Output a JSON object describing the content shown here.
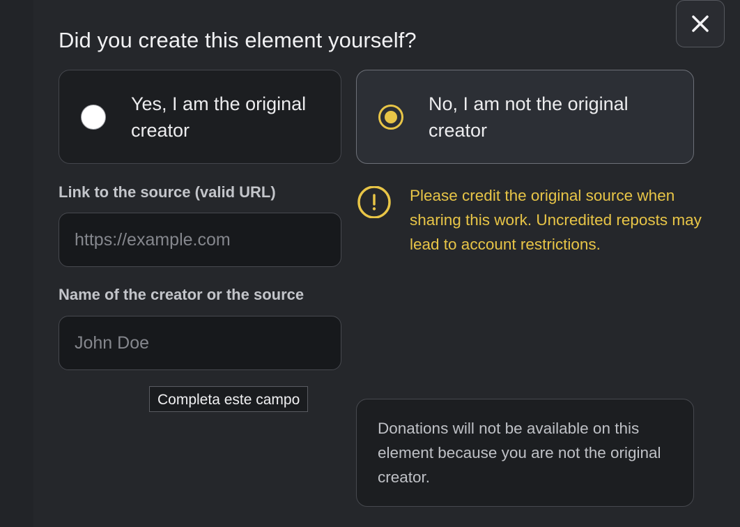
{
  "dialog": {
    "title": "Did you create this element yourself?",
    "close_icon": "close-icon"
  },
  "options": {
    "yes": {
      "label": "Yes, I am the original creator",
      "selected": false
    },
    "no": {
      "label": "No, I am not the original creator",
      "selected": true
    }
  },
  "fields": {
    "link": {
      "label": "Link to the source (valid URL)",
      "placeholder": "https://example.com",
      "value": ""
    },
    "name": {
      "label": "Name of the creator or the source",
      "placeholder": "John Doe",
      "value": ""
    }
  },
  "validation": {
    "tooltip": "Completa este campo"
  },
  "warning": {
    "icon": "exclamation-circle-icon",
    "text": "Please credit the original source when sharing this work. Uncredited reposts may lead to account restrictions."
  },
  "info": {
    "text": "Donations will not be available on this element because you are not the original creator."
  },
  "colors": {
    "background": "#25272b",
    "accent": "#e8c547",
    "input_bg": "#17191c",
    "selected_card_bg": "#2c2f35"
  }
}
